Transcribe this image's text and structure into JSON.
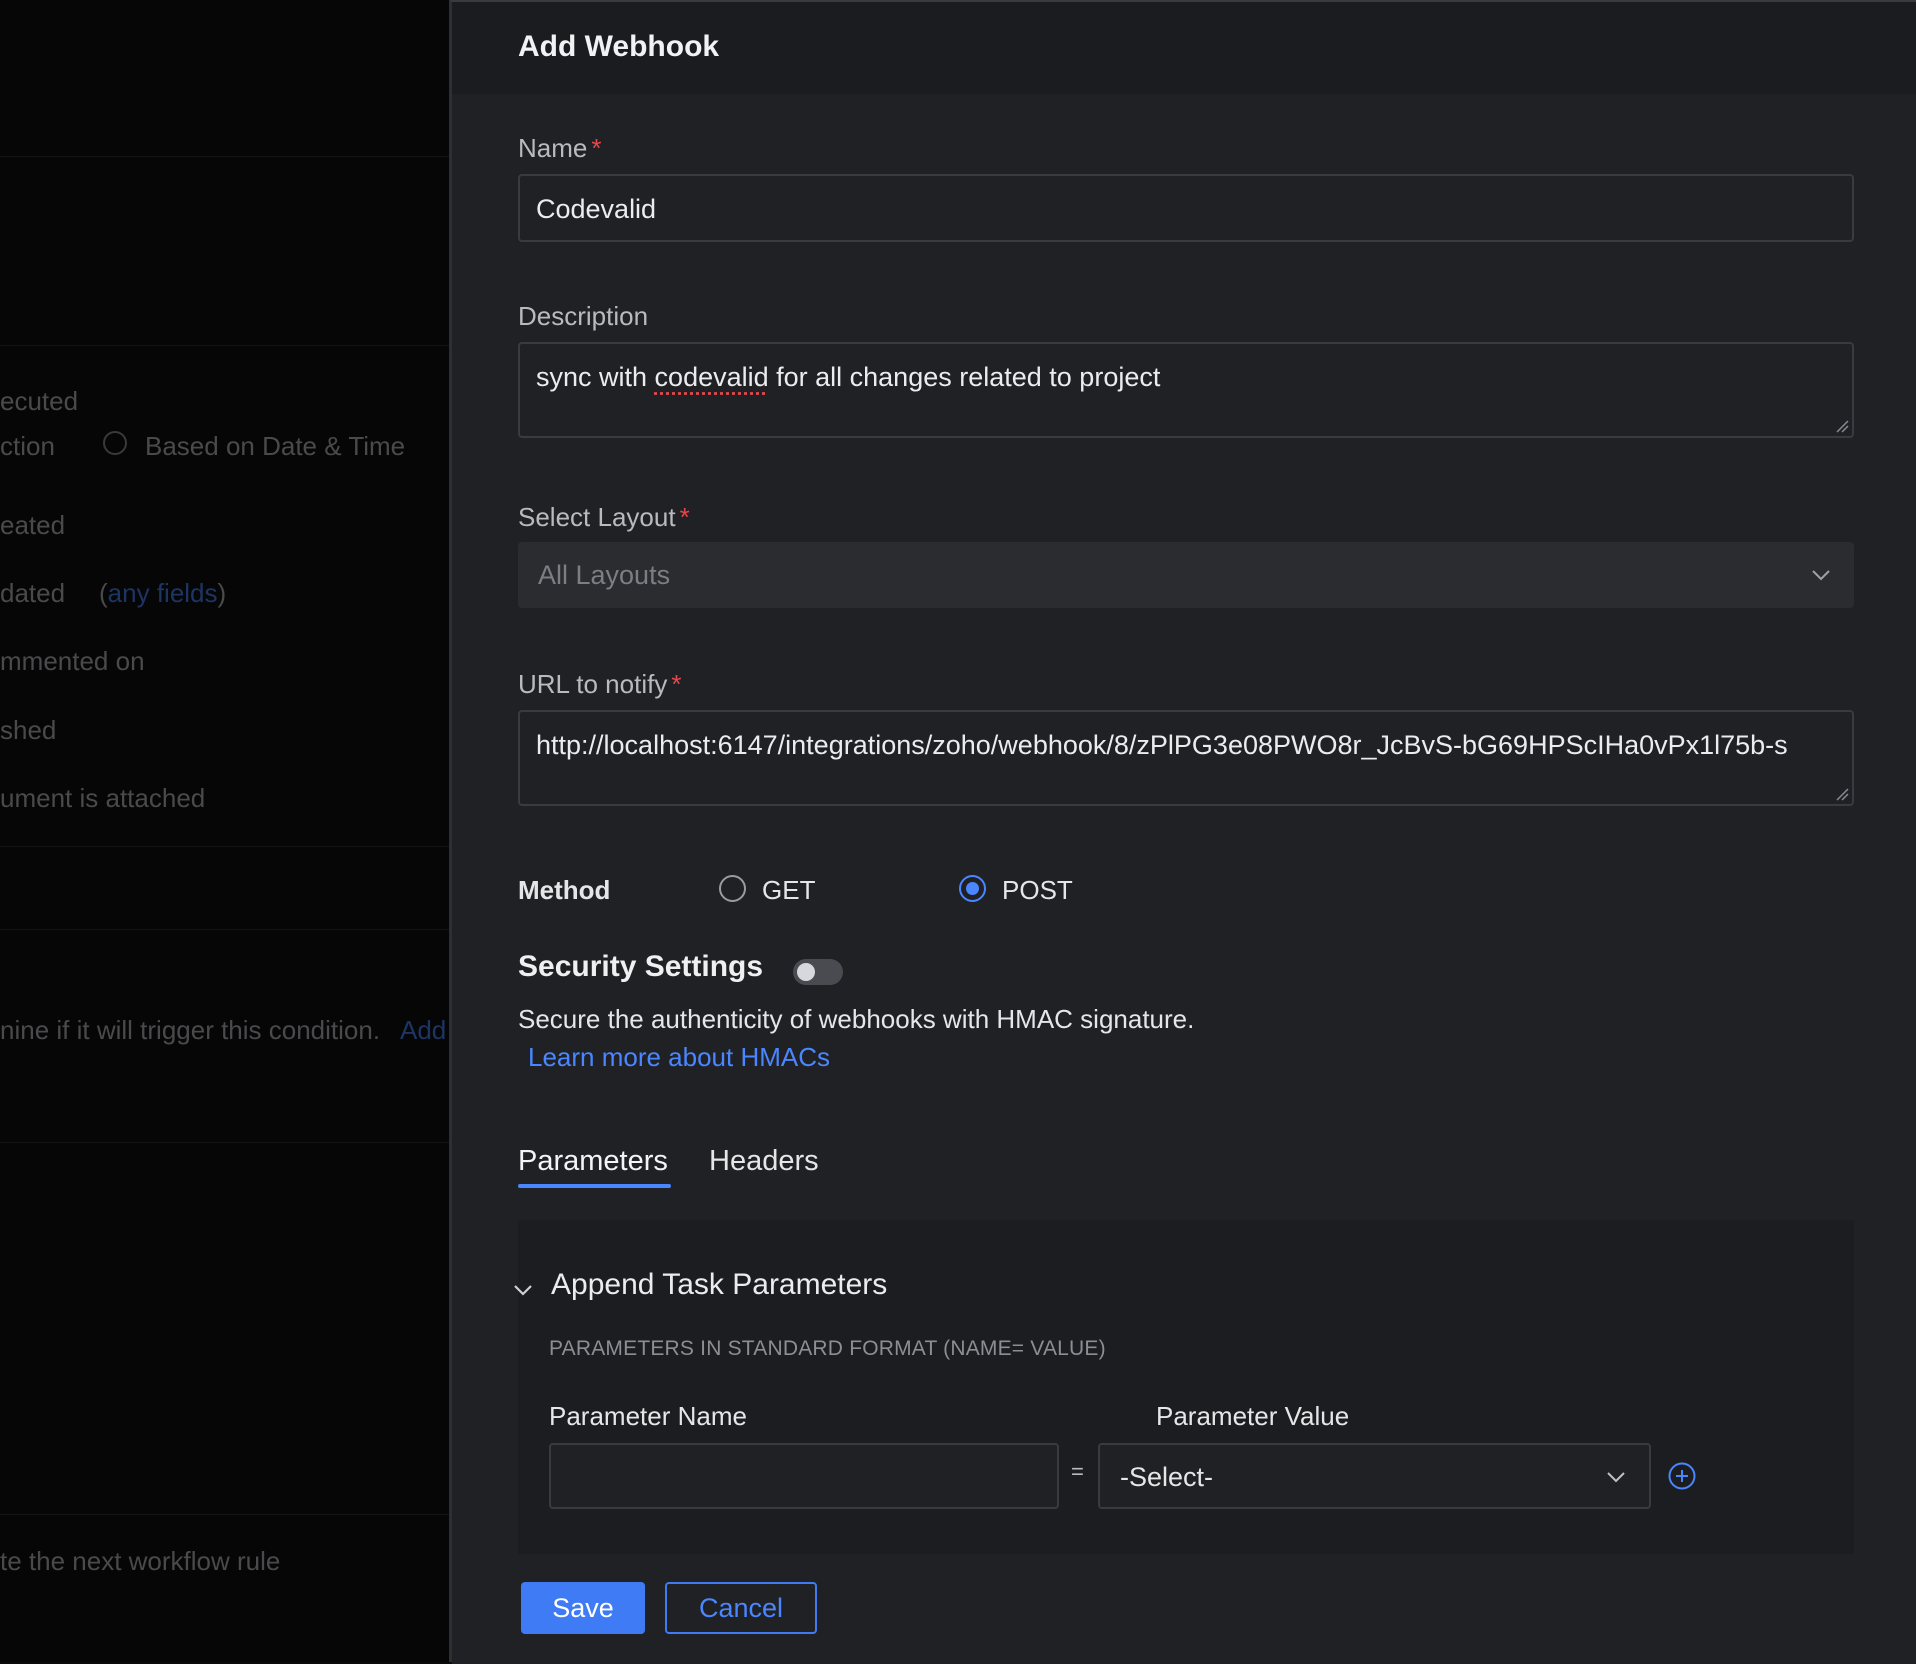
{
  "background": {
    "texts": [
      "ecuted",
      "ction",
      "Based on Date & Time",
      "eated",
      "dated",
      "any fields",
      "mmented on",
      "shed",
      "ument is attached",
      "nine if it will trigger this condition.",
      "Add",
      "te the next workflow rule"
    ]
  },
  "modal": {
    "title": "Add Webhook",
    "name": {
      "label": "Name",
      "required": "*",
      "value": "Codevalid"
    },
    "description": {
      "label": "Description",
      "value_pre": "sync with ",
      "value_misspelled": "codevalid",
      "value_post": " for all changes related to project"
    },
    "layout": {
      "label": "Select Layout",
      "required": "*",
      "value": "All Layouts"
    },
    "url": {
      "label": "URL to notify",
      "required": "*",
      "value": "http://localhost:6147/integrations/zoho/webhook/8/zPlPG3e08PWO8r_JcBvS-bG69HPScIHa0vPx1l75b-s"
    },
    "method": {
      "label": "Method",
      "options": [
        "GET",
        "POST"
      ],
      "selected": "POST"
    },
    "security": {
      "title": "Security Settings",
      "enabled": false,
      "description": "Secure the authenticity of webhooks with HMAC signature.",
      "link": "Learn more about HMACs"
    },
    "tabs": [
      {
        "label": "Parameters",
        "active": true
      },
      {
        "label": "Headers",
        "active": false
      }
    ],
    "parameters": {
      "section_title": "Append Task Parameters",
      "format_note": "PARAMETERS IN STANDARD FORMAT (NAME= VALUE)",
      "name_label": "Parameter Name",
      "value_label": "Parameter Value",
      "equals": "=",
      "value_placeholder": "-Select-"
    },
    "buttons": {
      "save": "Save",
      "cancel": "Cancel"
    }
  },
  "colors": {
    "accent": "#3f7bf5",
    "required": "#e5484d",
    "modal_bg": "#202124"
  }
}
